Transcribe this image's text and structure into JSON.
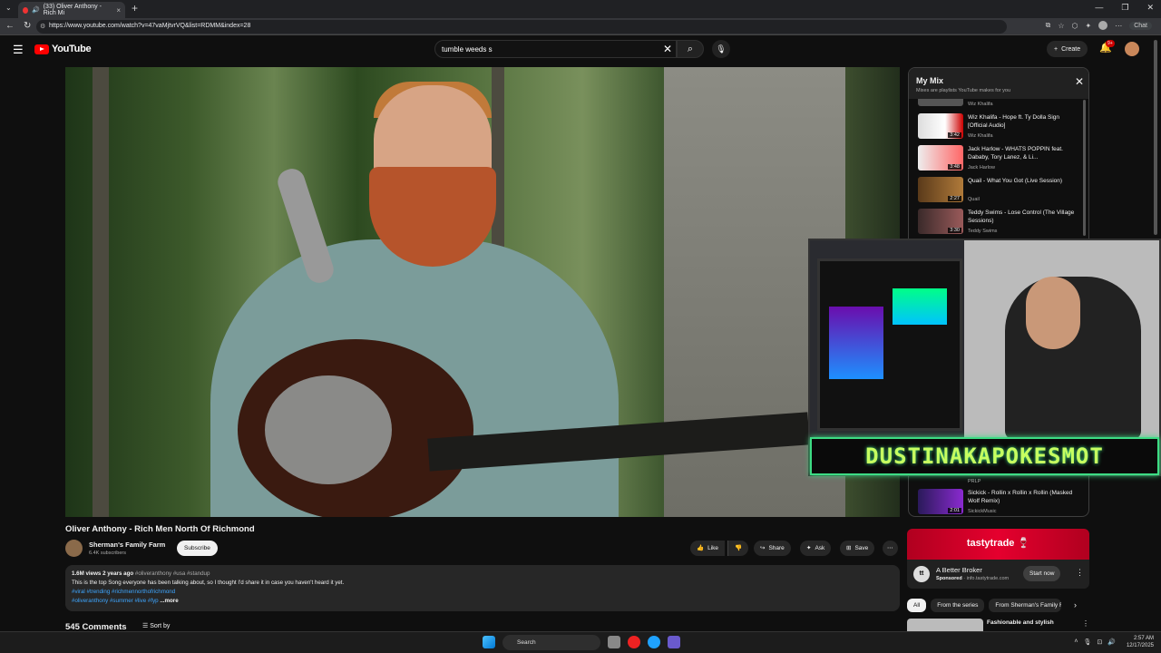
{
  "browser": {
    "tab_title": "(33) Oliver Anthony - Rich Mi",
    "url": "https://www.youtube.com/watch?v=47vaMjtvrVQ&list=RDMM&index=28",
    "chat_label": "Chat",
    "new_tab": "+",
    "tab_close": "×"
  },
  "header": {
    "logo_text": "YouTube",
    "search_value": "tumble weeds s",
    "create_label": "Create",
    "notification_count": "9+"
  },
  "video": {
    "title": "Oliver Anthony - Rich Men North Of Richmond",
    "channel_name": "Sherman's Family Farm",
    "subscribers": "6.4K subscribers",
    "subscribe_label": "Subscribe",
    "like_label": "Like",
    "share_label": "Share",
    "ask_label": "Ask",
    "save_label": "Save",
    "description": {
      "views": "1.6M views",
      "age": "2 years ago",
      "tags_top": "#oliveranthony #usa #standup",
      "text": "This is the top Song everyone has been talking about, so I thought I'd share it in case you haven't heard it yet.",
      "tags_line2": "#viral #trending #richmennorthofrichmond",
      "tags_line3": "#oliveranthony #summer #live #fyp",
      "more": "...more"
    },
    "comments_label": "545 Comments",
    "sort_label": "Sort by"
  },
  "webcam": {
    "banner_text": "DUSTINAKAPOKESMOT"
  },
  "mix": {
    "title": "My Mix",
    "subtitle": "Mixes are playlists YouTube makes for you",
    "partial_channel": "Wiz Khalifa",
    "items": [
      {
        "title": "Wiz Khalifa - Hope ft. Ty Dolla Sign [Official Audio]",
        "channel": "Wiz Khalifa",
        "duration": "3:42"
      },
      {
        "title": "Jack Harlow - WHATS POPPIN feat. Dababy, Tory Lanez, & Li...",
        "channel": "Jack Harlow",
        "duration": "3:48"
      },
      {
        "title": "Quail - What You Got (Live Session)",
        "channel": "Quail",
        "duration": "2:27"
      },
      {
        "title": "Teddy Swims - Lose Control (The Village Sessions)",
        "channel": "Teddy Swims",
        "duration": "3:30"
      }
    ],
    "lower_partial": "PRLP",
    "lower_item": {
      "title": "Sickick - Rollin x Rollin x Rollin (Masked Wolf Remix)",
      "channel": "SickickMusic",
      "duration": "2:01"
    }
  },
  "ad": {
    "brand": "tastytrade",
    "name": "A Better Broker",
    "sponsored": "Sponsored",
    "domain": "info.tastytrade.com",
    "cta": "Start now"
  },
  "chips": [
    "All",
    "From the series",
    "From Sherman's Family F"
  ],
  "next_video": {
    "title": "Fashionable and stylish"
  },
  "taskbar": {
    "search_label": "Search",
    "time": "2:57 AM",
    "date": "12/17/2025"
  },
  "colors": {
    "accent": "#ff0000",
    "link": "#3ea6ff",
    "banner": "#3ddc84"
  }
}
